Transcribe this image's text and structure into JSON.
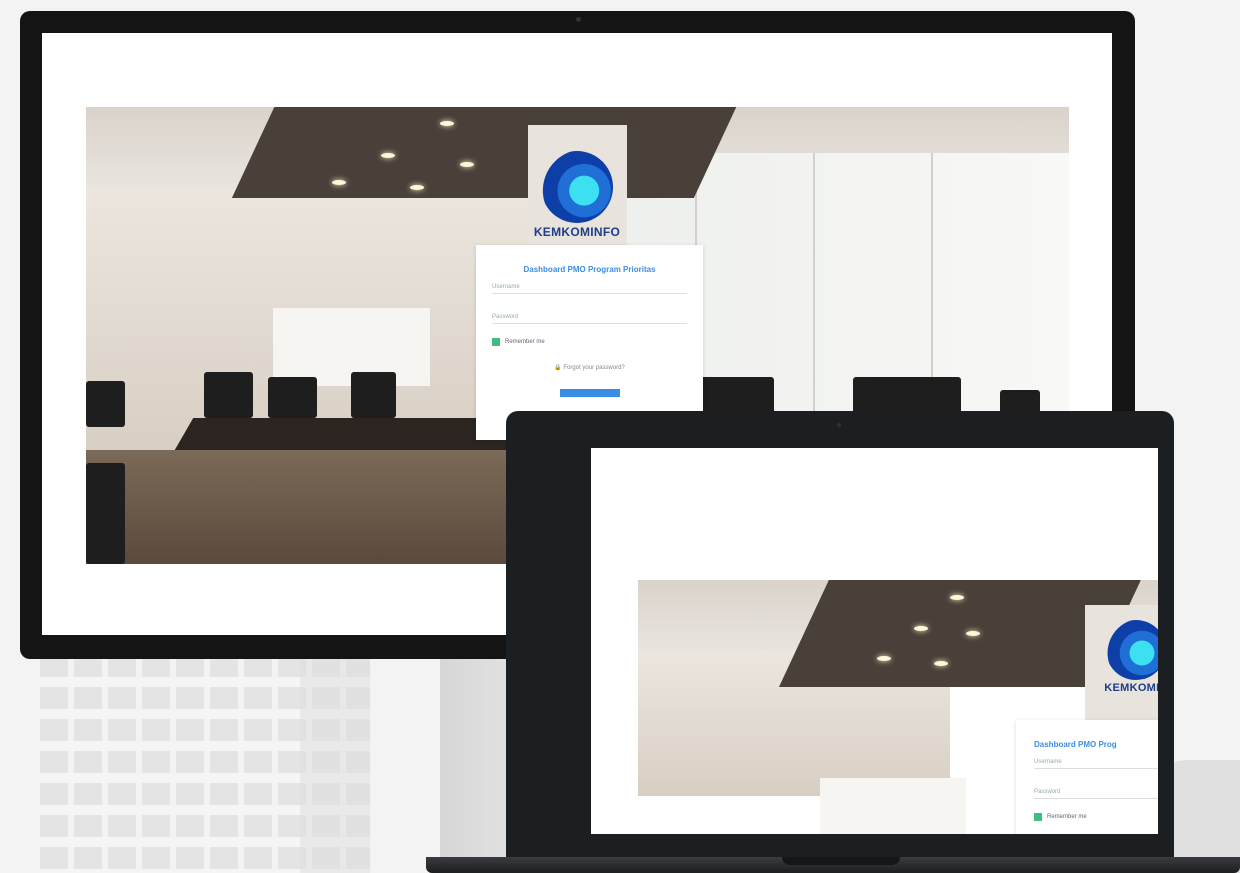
{
  "brand": {
    "logo_text": "KEMKOMINFO",
    "accent": "#3a8ee6",
    "check_color": "#3fbf7f"
  },
  "login": {
    "title": "Dashboard PMO Program Prioritas",
    "username_placeholder": "Username",
    "password_placeholder": "Password",
    "remember_label": "Remember me",
    "forgot_label": "Forgot your password?",
    "forgot_icon": "lock-icon"
  },
  "laptop_login": {
    "title": "Dashboard PMO Prog",
    "username_placeholder": "Username",
    "password_placeholder": "Password",
    "remember_label": "Remember me",
    "logo_text": "KEMKOMIN"
  },
  "devices": [
    "desktop-monitor",
    "laptop"
  ]
}
